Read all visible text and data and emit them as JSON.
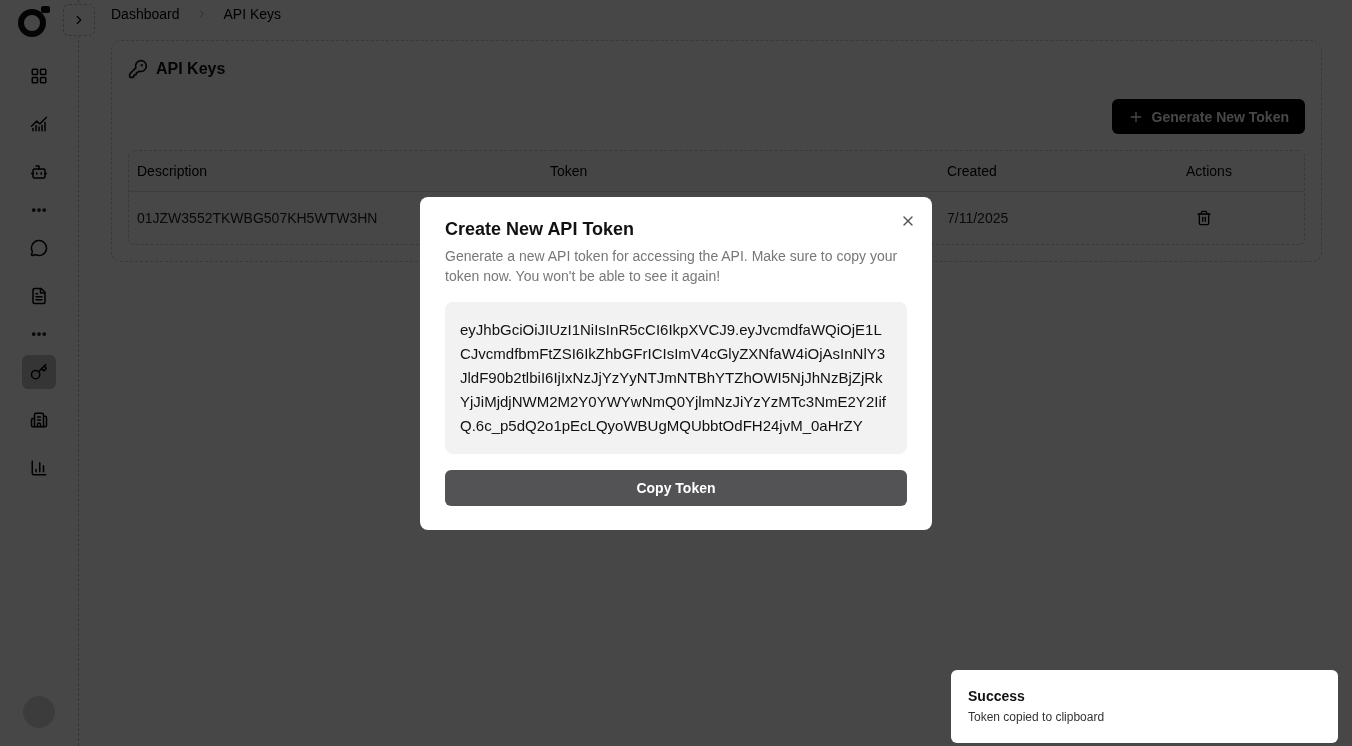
{
  "sidebar": {
    "items": [
      {
        "kind": "icon",
        "selected": false
      },
      {
        "kind": "icon",
        "selected": false
      },
      {
        "kind": "icon",
        "selected": false
      },
      {
        "kind": "more"
      },
      {
        "kind": "icon",
        "selected": false
      },
      {
        "kind": "icon",
        "selected": false
      },
      {
        "kind": "more"
      },
      {
        "kind": "icon",
        "selected": true
      },
      {
        "kind": "icon",
        "selected": false
      },
      {
        "kind": "icon",
        "selected": false
      }
    ]
  },
  "breadcrumb": [
    "Dashboard",
    "API Keys"
  ],
  "card": {
    "title": "API Keys",
    "generate_button": "Generate New Token",
    "table": {
      "columns": [
        "Description",
        "Token",
        "Created",
        "Actions"
      ],
      "rows": [
        {
          "description": "01JZW3552TKWBG507KH5WTW3HN",
          "created": "7/11/2025"
        }
      ]
    }
  },
  "dialog": {
    "title": "Create New API Token",
    "description": "Generate a new API token for accessing the API. Make sure to copy your token now. You won't be able to see it again!",
    "token": "eyJhbGciOiJIUzI1NiIsInR5cCI6IkpXVCJ9.eyJvcmdfaWQiOjE1LCJvcmdfbmFtZSI6IkZhbGFrICIsImV4cGlyZXNfaW4iOjAsInNlY3JldF90b2tlbiI6IjIxNzJjYzYyNTJmNTBhYTZhOWI5NjJhNzBjZjRkYjJiMjdjNWM2M2Y0YWYwNmQ0YjlmNzJiYzYzMTc3NmE2Y2IifQ.6c_p5dQ2o1pEcLQyoWBUgMQUbbtOdFH24jvM_0aHrZY",
    "copy_button": "Copy Token"
  },
  "toast": {
    "title": "Success",
    "message": "Token copied to clipboard"
  }
}
